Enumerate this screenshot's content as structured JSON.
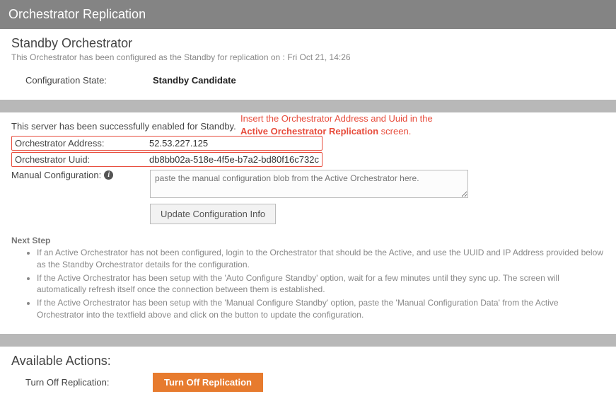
{
  "header": {
    "title": "Orchestrator Replication"
  },
  "standby": {
    "title": "Standby Orchestrator",
    "subtext": "This Orchestrator has been configured as the Standby for replication on : Fri Oct 21, 14:26",
    "config_state_label": "Configuration State:",
    "config_state_value": "Standby Candidate"
  },
  "details": {
    "status_line": "This server has been successfully enabled for Standby.",
    "address_label": "Orchestrator Address:",
    "address_value": "52.53.227.125",
    "uuid_label": "Orchestrator Uuid:",
    "uuid_value": "db8bb02a-518e-4f5e-b7a2-bd80f16c732c",
    "manual_label": "Manual Configuration:",
    "manual_placeholder": "paste the manual configuration blob from the Active Orchestrator here.",
    "update_button": "Update Configuration Info"
  },
  "annotation": {
    "line1": "Insert the Orchestrator Address and Uuid in the",
    "line2_bold": "Active Orchestrator Replication",
    "line2_tail": " screen."
  },
  "next_step": {
    "title": "Next Step",
    "items": [
      "If an Active Orchestrator has not been configured, login to the Orchestrator that should be the Active, and use the UUID and IP Address provided below as the Standby Orchestrator details for the configuration.",
      "If the Active Orchestrator has been setup with the 'Auto Configure Standby' option, wait for a few minutes until they sync up. The screen will automatically refresh itself once the connection between them is established.",
      "If the Active Orchestrator has been setup with the 'Manual Configure Standby' option, paste the 'Manual Configuration Data' from the Active Orchestrator into the textfield above and click on the button to update the configuration."
    ]
  },
  "actions": {
    "title": "Available Actions:",
    "turn_off_label": "Turn Off Replication:",
    "turn_off_button": "Turn Off Replication"
  }
}
